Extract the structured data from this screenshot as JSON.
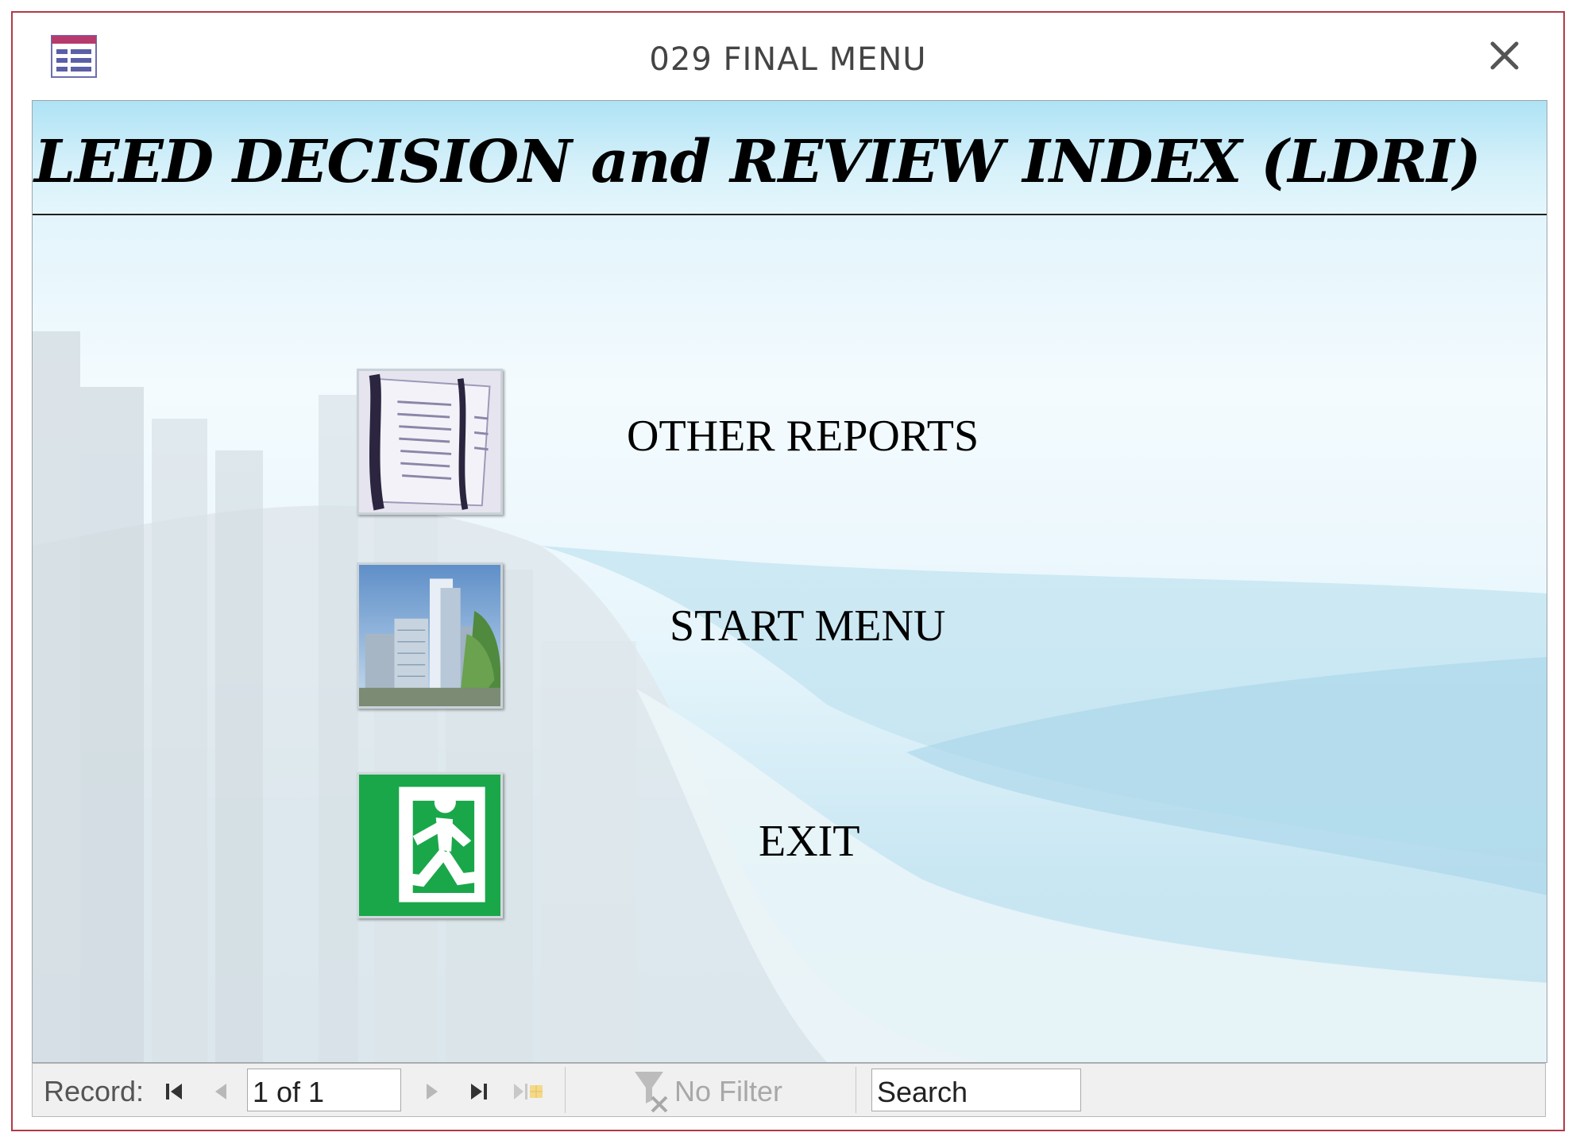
{
  "window": {
    "title": "029 FINAL MENU"
  },
  "form": {
    "title": "LEED DECISION and REVIEW INDEX (LDRI)"
  },
  "menu": {
    "items": [
      {
        "label": "OTHER REPORTS",
        "icon": "reports-document-icon"
      },
      {
        "label": "START MENU",
        "icon": "city-buildings-icon"
      },
      {
        "label": "EXIT",
        "icon": "exit-running-man-icon"
      }
    ]
  },
  "navigation": {
    "record_label": "Record:",
    "record_value": "1 of 1",
    "filter_label": "No Filter",
    "search_value": "Search"
  },
  "colors": {
    "window_border": "#b03a48",
    "exit_green": "#1aa74a",
    "sky_blue": "#bfe7f6"
  }
}
